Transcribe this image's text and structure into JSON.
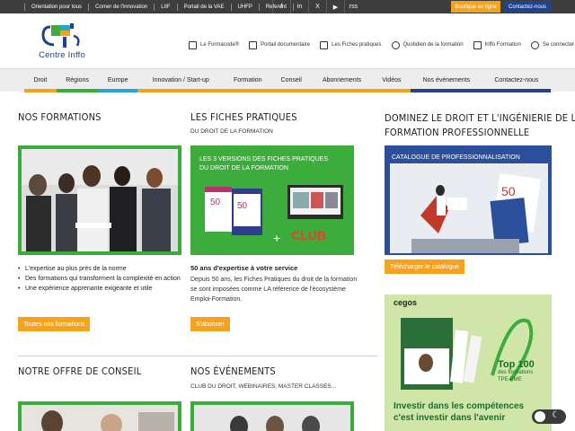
{
  "topbar": {
    "links": [
      "Orientation pour tous",
      "Corner de l'innovation",
      "LIIF",
      "Portail de la VAE",
      "UHFP",
      "Referent"
    ],
    "social": [
      "f",
      "in",
      "X",
      "▶",
      "rss"
    ],
    "shop_label": "Boutique en ligne",
    "contact_label": "Contactez-nous"
  },
  "logo": {
    "text": "Centre Inffo"
  },
  "utilnav": [
    {
      "label": "Le Formacode®",
      "icon": "document-icon"
    },
    {
      "label": "Portail documentaire",
      "icon": "folder-icon"
    },
    {
      "label": "Les Fiches pratiques",
      "icon": "file-icon"
    },
    {
      "label": "Quotidien de la formation",
      "icon": "send-icon"
    },
    {
      "label": "Inffo Formation",
      "icon": "newspaper-icon"
    },
    {
      "label": "Se connecter",
      "icon": "lock-icon"
    }
  ],
  "mainnav": [
    {
      "label": "Droit",
      "color": "#f5a21d"
    },
    {
      "label": "Régions",
      "color": "#3cac3c"
    },
    {
      "label": "Europe",
      "color": "#1fa7d6"
    },
    {
      "label": "Innovation / Start-up",
      "color": "#f5a21d"
    },
    {
      "label": "Formation",
      "color": "#f5a21d"
    },
    {
      "label": "Conseil",
      "color": "#f5a21d"
    },
    {
      "label": "Abonnements",
      "color": "#f5a21d"
    },
    {
      "label": "Vidéos",
      "color": "#f5a21d"
    },
    {
      "label": "Nos événements",
      "color": "#21428e"
    },
    {
      "label": "Contactez-nous",
      "color": "#21428e"
    }
  ],
  "col1": {
    "title": "NOS FORMATIONS",
    "bullets": [
      "L'expertise au plus près de la norme",
      "Des formations qui transforment la complexité en action",
      "Une expérience apprenante exigeante et utile"
    ],
    "button": "Toutes nos formations",
    "title2": "NOTRE OFFRE DE CONSEIL"
  },
  "col2": {
    "title": "LES FICHES PRATIQUES",
    "subtitle": "DU DROIT DE LA FORMATION",
    "banner_line1": "LES 3 VERSIONS DES FICHES PRATIQUES",
    "banner_line2": "DU DROIT DE LA FORMATION",
    "club_label": "CLUB",
    "strong": "50 ans d'expertise à votre service",
    "para": "Depuis 50 ans, les Fiches Pratiques du droit de la formation se sont imposées comme LA référence de l'écosystème Emploi-Formation.",
    "button": "S'abonner",
    "title2": "NOS ÉVÉNEMENTS",
    "subtitle2": "CLUB DU DROIT, WEBINAIRES, MASTER CLASSES..."
  },
  "col3": {
    "title_line1": "DOMINEZ LE DROIT ET L'INGÉNIERIE DE LA",
    "title_line2": "FORMATION PROFESSIONNELLE",
    "catalogue_label": "CATALOGUE DE PROFESSIONNALISATION",
    "button": "Télécharger le catalogue",
    "cegos_brand": "cegos",
    "top_line1": "Top 100",
    "top_line2": "des formations",
    "top_line3": "TPE-PME",
    "bottom_line1": "Investir dans les compétences",
    "bottom_line2": "c'est investir dans l'avenir"
  }
}
